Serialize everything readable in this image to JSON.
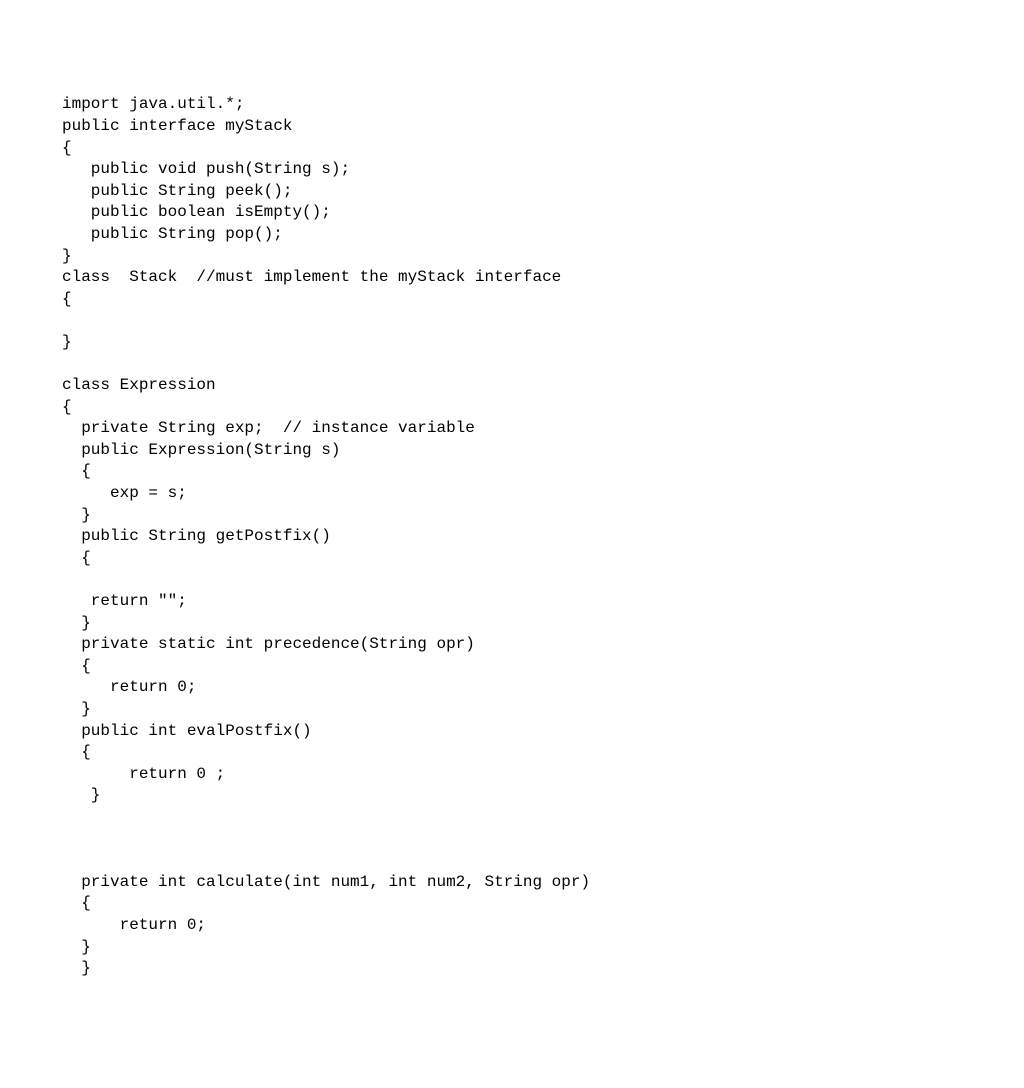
{
  "code": {
    "lines": [
      "import java.util.*;",
      "public interface myStack",
      "{",
      "   public void push(String s);",
      "   public String peek();",
      "   public boolean isEmpty();",
      "   public String pop();",
      "}",
      "class  Stack  //must implement the myStack interface",
      "{",
      "",
      "}",
      "",
      "class Expression",
      "{",
      "  private String exp;  // instance variable",
      "  public Expression(String s)",
      "  {",
      "     exp = s;",
      "  }",
      "  public String getPostfix()",
      "  {",
      "",
      "   return \"\";",
      "  }",
      "  private static int precedence(String opr)",
      "  {",
      "     return 0;",
      "  }",
      "  public int evalPostfix()",
      "  {",
      "       return 0 ;",
      "   }",
      "",
      "",
      "",
      "  private int calculate(int num1, int num2, String opr)",
      "  {",
      "      return 0;",
      "  }",
      "  }"
    ]
  }
}
